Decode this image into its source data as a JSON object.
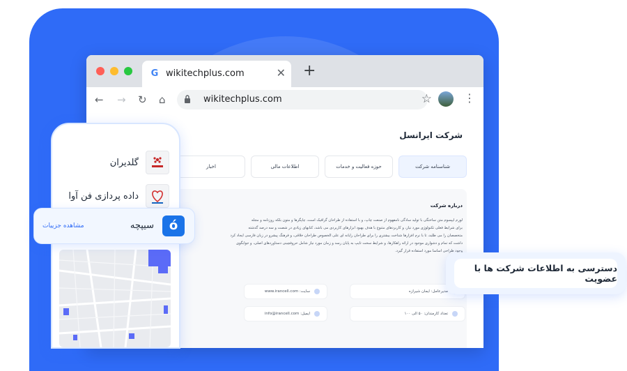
{
  "browser": {
    "tab_title": "wikitechplus.com",
    "url": "wikitechplus.com"
  },
  "page": {
    "company_title": "شرکت ایرانسل",
    "tabs": [
      {
        "label": "شناسنامه شرکت",
        "active": true
      },
      {
        "label": "حوزه فعالیت و خدمات"
      },
      {
        "label": "اطلاعات مالی"
      },
      {
        "label": "اخبار"
      }
    ],
    "about_heading": "درباره شرکت",
    "about_lines": [
      "لورم ایپسوم متن ساختگی با تولید سادگی نامفهوم از صنعت چاپ، و با استفاده از طراحان گرافیک است، چاپگرها و متون بلکه روزنامه و مجله",
      "برای شرایط فعلی تکنولوژی مورد نیاز، و کاربردهای متنوع با هدف بهبود ابزارهای کاربردی می باشد، کتابهای زیادی در شصت و سه درصد گذشته",
      "متخصصان را می طلبد، تا با نرم افزارها شناخت بیشتری را برای طراحان رایانه ای علی الخصوص طراحان خلاقی، و فرهنگ پیشرو در زبان فارسی ایجاد کرد",
      "داشت که تمام و دشواری موجود در ارائه راهکارها، و شرایط سخت تایپ به پایان رسد و زمان مورد نیاز شامل حروفچینی دستاوردهای اصلی، و جوابگوی",
      "وجود طراحی اساسا مورد استفاده قرار گیرد."
    ],
    "info": [
      {
        "text": "مدیرعامل: ایمان شیرازه"
      },
      {
        "text": "تعداد کارمندان: ۵۰ الی ۱۰۰"
      },
      {
        "text": "سایت: www.irancell.com"
      },
      {
        "text": "ایمیل: info@irancell.com"
      }
    ]
  },
  "phone": {
    "companies": [
      {
        "name": "گلدیران"
      },
      {
        "name": "داده پردازی فن آوا"
      }
    ]
  },
  "highlight_card": {
    "name": "سیپچه",
    "link": "مشاهده جزییات"
  },
  "callout": {
    "text": "دسترسی به  اطلاعات شرکت ها با عضویت"
  },
  "colors": {
    "accent": "#2f6bf7"
  }
}
